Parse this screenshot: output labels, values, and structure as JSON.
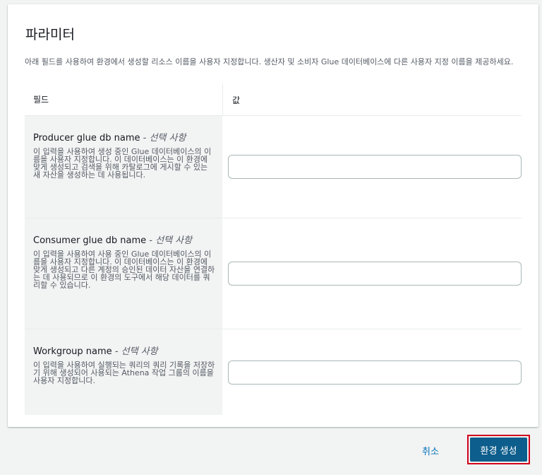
{
  "panel": {
    "title": "파라미터",
    "description": "아래 필드를 사용하여 환경에서 생성할 리소스 이름을 사용자 지정합니다. 생산자 및 소비자 Glue 데이터베이스에 다른 사용자 지정 이름을 제공하세요."
  },
  "table": {
    "header_field": "필드",
    "header_value": "값",
    "rows": [
      {
        "label": "Producer glue db name",
        "optional": " - 선택 사항",
        "help": "이 입력을 사용하여 생성 중인 Glue 데이터베이스의 이름을 사용자 지정합니다. 이 데이터베이스는 이 환경에 맞게 생성되고 검색을 위해 카탈로그에 게시할 수 있는 새 자산을 생성하는 데 사용됩니다.",
        "value": ""
      },
      {
        "label": "Consumer glue db name",
        "optional": " - 선택 사항",
        "help": "이 입력을 사용하여 사용 중인 Glue 데이터베이스의 이름을 사용자 지정합니다. 이 데이터베이스는 이 환경에 맞게 생성되고 다른 계정의 승인된 데이터 자산을 연결하는 데 사용되므로 이 환경의 도구에서 해당 데이터를 쿼리할 수 있습니다.",
        "value": ""
      },
      {
        "label": "Workgroup name",
        "optional": " - 선택 사항",
        "help": "이 입력을 사용하여 실행되는 쿼리의 쿼리 기록을 저장하기 위해 생성되어 사용되는 Athena 작업 그룹의 이름을 사용자 지정합니다.",
        "value": ""
      }
    ]
  },
  "footer": {
    "cancel_label": "취소",
    "submit_label": "환경 생성"
  },
  "colors": {
    "primary_button": "#0d5e8c",
    "link": "#0073bb",
    "highlight_outline": "#d0021b"
  }
}
